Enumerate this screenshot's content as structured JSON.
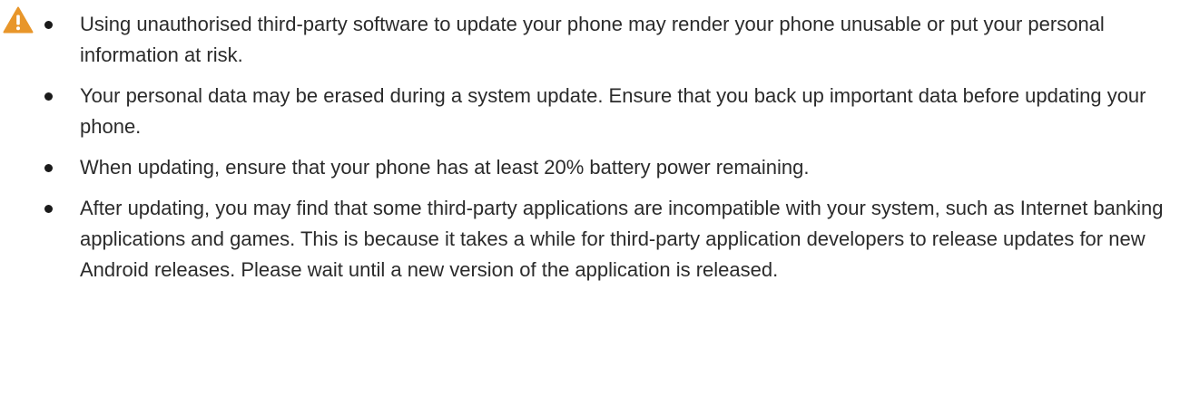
{
  "warning": {
    "icon": "warning-icon",
    "icon_color": "#e8962a",
    "items": [
      "Using unauthorised third-party software to update your phone may render your phone unusable or put your personal information at risk.",
      "Your personal data may be erased during a system update. Ensure that you back up important data before updating your phone.",
      "When updating, ensure that your phone has at least 20% battery power remaining.",
      "After updating, you may find that some third-party applications are incompatible with your system, such as Internet banking applications and games. This is because it takes a while for third-party application developers to release updates for new Android releases. Please wait until a new version of the application is released."
    ]
  }
}
